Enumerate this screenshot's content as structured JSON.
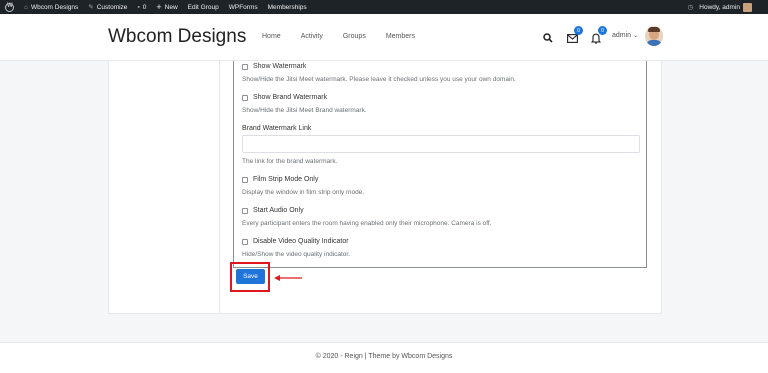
{
  "adminbar": {
    "site_name": "Wbcom Designs",
    "customize": "Customize",
    "comments_count": "0",
    "new": "New",
    "edit_group": "Edit Group",
    "wpforms": "WPForms",
    "memberships": "Memberships",
    "howdy": "Howdy, admin"
  },
  "header": {
    "site_title": "Wbcom Designs",
    "nav": [
      "Home",
      "Activity",
      "Groups",
      "Members"
    ],
    "messages_count": "0",
    "notifications_count": "0",
    "user_label": "admin"
  },
  "settings": [
    {
      "label": "Show Watermark",
      "desc": "Show/Hide the Jitsi Meet watermark. Please leave it checked unless you use your own domain."
    },
    {
      "label": "Show Brand Watermark",
      "desc": "Show/Hide the Jitsi Meet Brand watermark."
    },
    {
      "label": "Brand Watermark Link",
      "desc": "The link for the brand watermark.",
      "value": ""
    },
    {
      "label": "Film Strip Mode Only",
      "desc": "Display the window in film strip only mode."
    },
    {
      "label": "Start Audio Only",
      "desc": "Every participant enters the room having enabled only their microphone. Camera is off."
    },
    {
      "label": "Disable Video Quality Indicator",
      "desc": "Hide/Show the video quality indicator."
    }
  ],
  "save_label": "Save",
  "footer": "© 2020 - Reign | Theme by Wbcom Designs",
  "colors": {
    "accent": "#1e74d9",
    "highlight": "#e0181d"
  }
}
